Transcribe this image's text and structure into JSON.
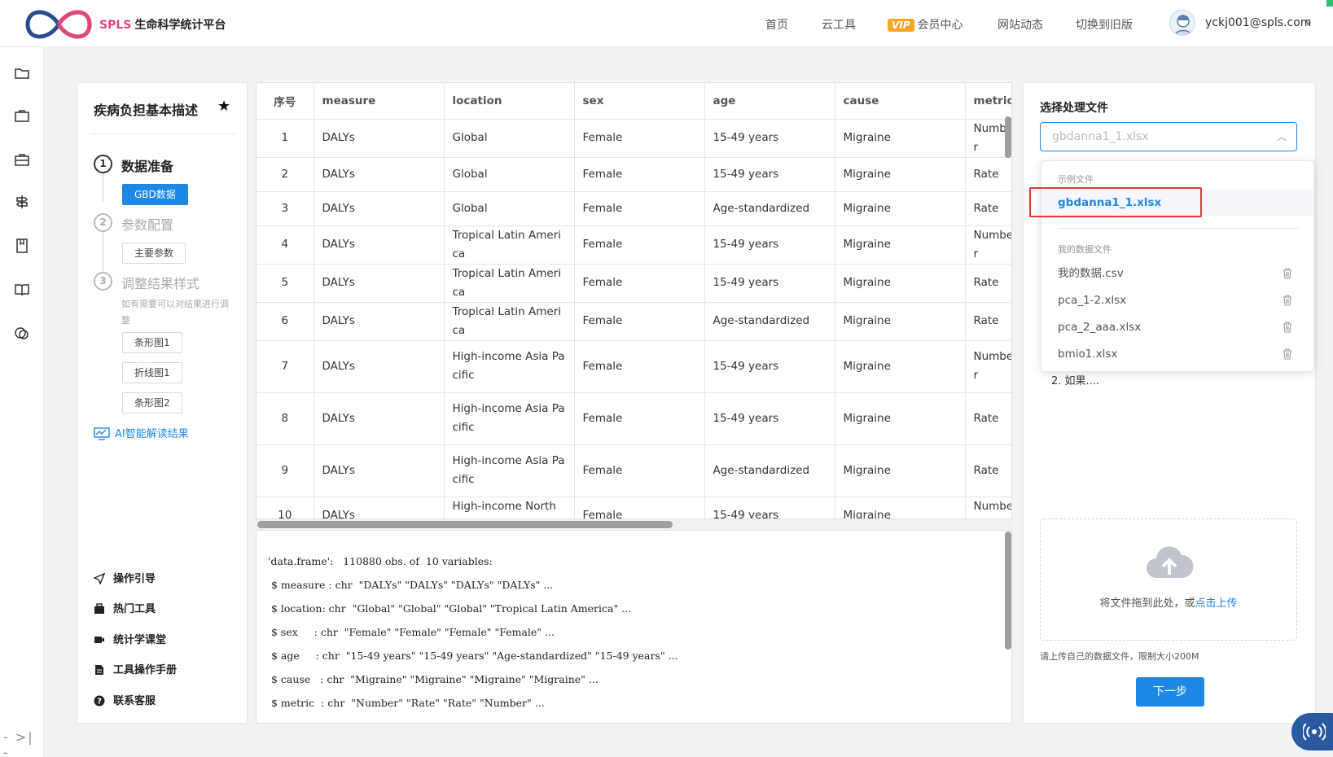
{
  "brand": {
    "name_en": "SPLS",
    "name_cn": "生命科学统计平台"
  },
  "nav": {
    "home": "首页",
    "cloud_tools": "云工具",
    "vip_badge": "VIP",
    "member_center": "会员中心",
    "site_news": "网站动态",
    "switch_old": "切换到旧版"
  },
  "user": {
    "email": "yckj001@spls.com"
  },
  "steps_panel": {
    "title": "疾病负担基本描述",
    "step1": {
      "num": "1",
      "label": "数据准备",
      "button": "GBD数据"
    },
    "step2": {
      "num": "2",
      "label": "参数配置",
      "button": "主要参数"
    },
    "step3": {
      "num": "3",
      "label": "调整结果样式",
      "hint": "如有需要可以对结果进行调整",
      "buttons": [
        "条形图1",
        "折线图1",
        "条形图2"
      ]
    },
    "ai_link": "AI智能解读结果",
    "links": [
      "操作引导",
      "热门工具",
      "统计学课堂",
      "工具操作手册",
      "联系客服"
    ]
  },
  "table": {
    "headers": [
      "序号",
      "measure",
      "location",
      "sex",
      "age",
      "cause",
      "metric"
    ],
    "rows": [
      [
        "1",
        "DALYs",
        "Global",
        "Female",
        "15-49 years",
        "Migraine",
        "Number"
      ],
      [
        "2",
        "DALYs",
        "Global",
        "Female",
        "15-49 years",
        "Migraine",
        "Rate"
      ],
      [
        "3",
        "DALYs",
        "Global",
        "Female",
        "Age-standardized",
        "Migraine",
        "Rate"
      ],
      [
        "4",
        "DALYs",
        "Tropical Latin America",
        "Female",
        "15-49 years",
        "Migraine",
        "Number"
      ],
      [
        "5",
        "DALYs",
        "Tropical Latin America",
        "Female",
        "15-49 years",
        "Migraine",
        "Rate"
      ],
      [
        "6",
        "DALYs",
        "Tropical Latin America",
        "Female",
        "Age-standardized",
        "Migraine",
        "Rate"
      ],
      [
        "7",
        "DALYs",
        "High-income Asia Pacific",
        "Female",
        "15-49 years",
        "Migraine",
        "Number"
      ],
      [
        "8",
        "DALYs",
        "High-income Asia Pacific",
        "Female",
        "15-49 years",
        "Migraine",
        "Rate"
      ],
      [
        "9",
        "DALYs",
        "High-income Asia Pacific",
        "Female",
        "Age-standardized",
        "Migraine",
        "Rate"
      ],
      [
        "10",
        "DALYs",
        "High-income North America",
        "Female",
        "15-49 years",
        "Migraine",
        "Number"
      ]
    ]
  },
  "console": {
    "lines": [
      "'data.frame':   110880 obs. of  10 variables:",
      " $ measure : chr  \"DALYs\" \"DALYs\" \"DALYs\" \"DALYs\" ...",
      " $ location: chr  \"Global\" \"Global\" \"Global\" \"Tropical Latin America\" ...",
      " $ sex     : chr  \"Female\" \"Female\" \"Female\" \"Female\" ...",
      " $ age     : chr  \"15-49 years\" \"15-49 years\" \"Age-standardized\" \"15-49 years\" ...",
      " $ cause   : chr  \"Migraine\" \"Migraine\" \"Migraine\" \"Migraine\" ...",
      " $ metric  : chr  \"Number\" \"Rate\" \"Rate\" \"Number\" ..."
    ]
  },
  "right_panel": {
    "title": "选择处理文件",
    "select_placeholder": "gbdanna1_1.xlsx",
    "behind_text": "2. 如果....",
    "upload_text": "将文件拖到此处，或",
    "upload_link": "点击上传",
    "upload_hint": "请上传自己的数据文件，限制大小200M",
    "next_button": "下一步"
  },
  "dropdown": {
    "example_group": "示例文件",
    "example_files": [
      "gbdanna1_1.xlsx"
    ],
    "my_group": "我的数据文件",
    "my_files": [
      "我的数据.csv",
      "pca_1-2.xlsx",
      "pca_2_aaa.xlsx",
      "bmio1.xlsx"
    ]
  },
  "colors": {
    "primary": "#1e88e5",
    "brand_pink": "#e0487a",
    "highlight": "#e53935",
    "vip": "#f5a623"
  }
}
